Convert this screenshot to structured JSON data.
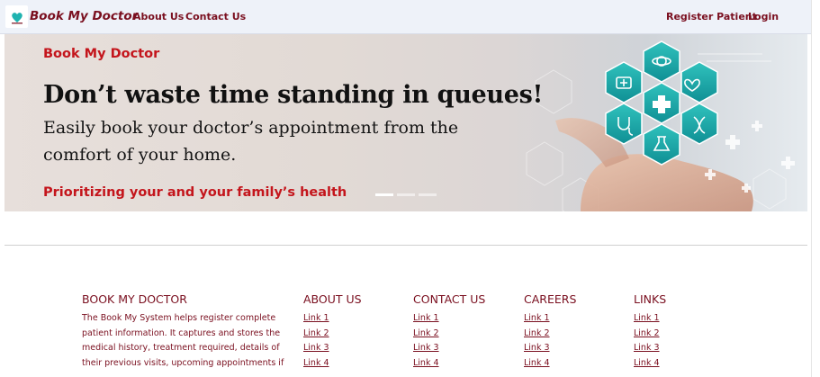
{
  "navbar": {
    "brand": "Book My Doctor",
    "logo_icon": "logo-icon",
    "links": {
      "about": "About Us",
      "contact": "Contact Us"
    },
    "actions": {
      "register": "Register Patient",
      "login": "Login"
    }
  },
  "hero": {
    "kicker": "Book My Doctor",
    "title": "Don’t waste time standing in queues!",
    "subtitle": "Easily book your doctor’s appointment from the comfort of your home.",
    "tagline": "Prioritizing your and your family’s health",
    "slides": 3,
    "active_slide": 1
  },
  "footer": {
    "about": {
      "heading": "BOOK MY DOCTOR",
      "text": "The Book My System helps register complete patient information. It captures and stores the medical history, treatment required, details of their previous visits, upcoming appointments if"
    },
    "columns": [
      {
        "heading": "ABOUT US",
        "links": [
          "Link 1",
          "Link 2",
          "Link 3",
          "Link 4"
        ]
      },
      {
        "heading": "CONTACT US",
        "links": [
          "Link 1",
          "Link 2",
          "Link 3",
          "Link 4"
        ]
      },
      {
        "heading": "CAREERS",
        "links": [
          "Link 1",
          "Link 2",
          "Link 3",
          "Link 4"
        ]
      },
      {
        "heading": "LINKS",
        "links": [
          "Link 1",
          "Link 2",
          "Link 3",
          "Link 4"
        ]
      }
    ]
  },
  "colors": {
    "brand": "#7a0f1f",
    "accent_red": "#c4151c",
    "navbar_bg": "#eef2f9",
    "hex_teal": "#1fb3b0"
  }
}
